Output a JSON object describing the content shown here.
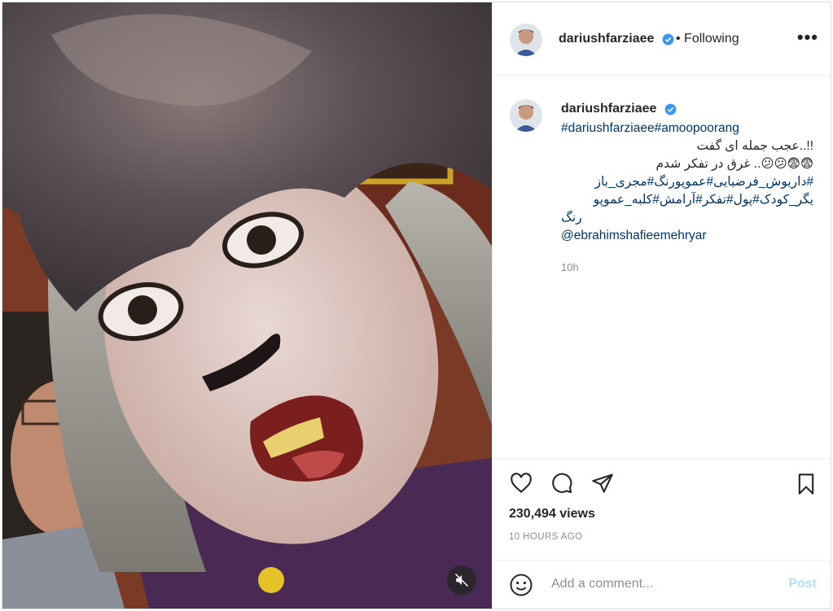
{
  "header": {
    "username": "dariushfarziaee",
    "follow_status": "• Following"
  },
  "caption": {
    "username": "dariushfarziaee",
    "hashtags_line": "#dariushfarziaee#amoopoorang",
    "line1": "!!..عجب جمله ای گفت",
    "line2": "😨😨😕😕.. غرق در تفکر شدم",
    "line3": "#داریوش_فرضیایی#عموپورنگ#مجری_باز",
    "line4": "یگر_کودک#پول#تفکر#آرامش#کلبه_عموپو",
    "line5": "رنگ",
    "mention": "@ebrahimshafieemehryar",
    "time": "10h"
  },
  "stats": {
    "views": "230,494 views",
    "posted_ago": "10 HOURS AGO"
  },
  "comment": {
    "placeholder": "Add a comment...",
    "post_label": "Post"
  },
  "colors": {
    "verified": "#3897f0",
    "link": "#00376b",
    "post_disabled": "#b2dffc"
  },
  "icons": [
    "more-options-icon",
    "heart-icon",
    "comment-icon",
    "share-icon",
    "bookmark-icon",
    "emoji-icon",
    "mute-icon",
    "verified-badge-icon"
  ]
}
